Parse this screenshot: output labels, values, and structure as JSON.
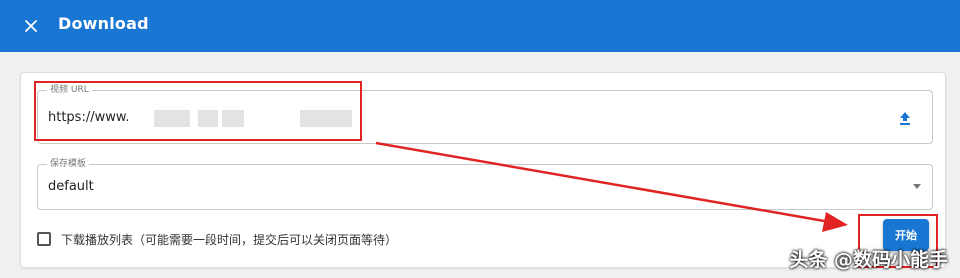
{
  "header": {
    "title": "Download",
    "close_icon": "close-icon",
    "background_color": "#1976d2"
  },
  "url_field": {
    "legend": "视频 URL",
    "value": "https://www.",
    "upload_icon": "upload-icon"
  },
  "template_field": {
    "legend": "保存模板",
    "value": "default",
    "dropdown_icon": "chevron-down-icon"
  },
  "playlist_option": {
    "label": "下载播放列表（可能需要一段时间，提交后可以关闭页面等待）",
    "checked": false
  },
  "start_button": {
    "label": "开始"
  },
  "annotations": {
    "color": "#e02424"
  },
  "watermark": {
    "text": "头条 @数码小能手"
  }
}
